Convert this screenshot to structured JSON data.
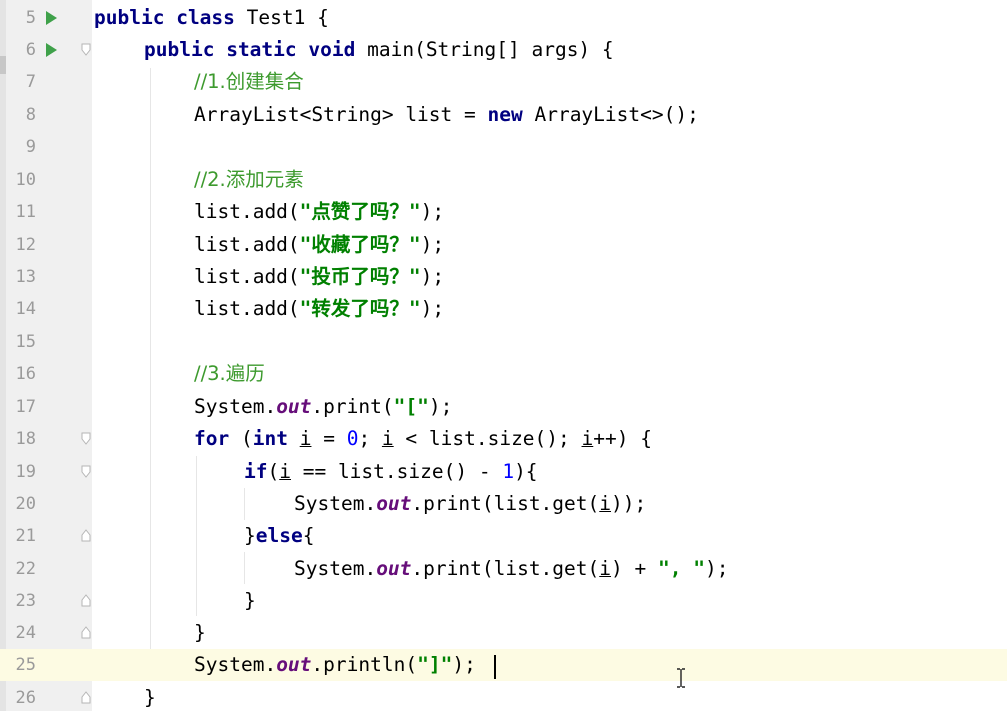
{
  "editor": {
    "lines": [
      {
        "num": "5",
        "text": "public class Test1 {"
      },
      {
        "num": "6",
        "text": "    public static void main(String[] args) {"
      },
      {
        "num": "7",
        "text": "        //1.创建集合"
      },
      {
        "num": "8",
        "text": "        ArrayList<String> list = new ArrayList<>();"
      },
      {
        "num": "9",
        "text": ""
      },
      {
        "num": "10",
        "text": "        //2.添加元素"
      },
      {
        "num": "11",
        "text": "        list.add(\"点赞了吗？\");"
      },
      {
        "num": "12",
        "text": "        list.add(\"收藏了吗？\");"
      },
      {
        "num": "13",
        "text": "        list.add(\"投币了吗？\");"
      },
      {
        "num": "14",
        "text": "        list.add(\"转发了吗？\");"
      },
      {
        "num": "15",
        "text": ""
      },
      {
        "num": "16",
        "text": "        //3.遍历"
      },
      {
        "num": "17",
        "text": "        System.out.print(\"[\");"
      },
      {
        "num": "18",
        "text": "        for (int i = 0; i < list.size(); i++) {"
      },
      {
        "num": "19",
        "text": "            if(i == list.size() - 1){"
      },
      {
        "num": "20",
        "text": "                System.out.print(list.get(i));"
      },
      {
        "num": "21",
        "text": "            }else{"
      },
      {
        "num": "22",
        "text": "                System.out.print(list.get(i) + \", \");"
      },
      {
        "num": "23",
        "text": "            }"
      },
      {
        "num": "24",
        "text": "        }"
      },
      {
        "num": "25",
        "text": "        System.out.println(\"]\");"
      },
      {
        "num": "26",
        "text": "    }"
      }
    ],
    "tokens": {
      "public": "public",
      "class": "class",
      "static": "static",
      "void": "void",
      "new": "new",
      "for": "for",
      "int": "int",
      "if": "if",
      "else": "else",
      "out": "out",
      "zero": "0",
      "one": "1"
    },
    "comments": {
      "c1": "//1.创建集合",
      "c2": "//2.添加元素",
      "c3": "//3.遍历"
    },
    "strings": {
      "s1": "\"点赞了吗？\"",
      "s2": "\"收藏了吗？\"",
      "s3": "\"投币了吗？\"",
      "s4": "\"转发了吗？\"",
      "s5": "\"[\"",
      "s6": "\", \"",
      "s7": "\"]\""
    },
    "current_line": "25",
    "run_gutter_icons": [
      "run-class",
      "run-main"
    ],
    "colors": {
      "keyword": "#000080",
      "string": "#008000",
      "number": "#0000ff",
      "comment": "#808080",
      "field": "#660e7a",
      "run_icon": "#3fa14a",
      "current_line_bg": "#fdfbe3"
    }
  }
}
